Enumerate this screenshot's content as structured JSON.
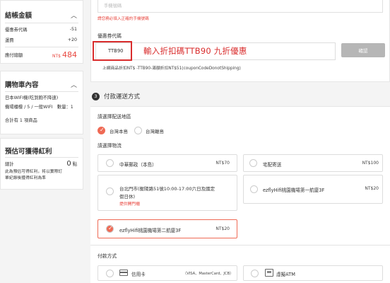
{
  "sidebar": {
    "checkout": {
      "title": "結帳金額",
      "rows": [
        {
          "label": "優惠券代碼",
          "value": "-51"
        },
        {
          "label": "運費",
          "value": "+20"
        }
      ],
      "total_label": "應付總額",
      "total_currency": "NT$",
      "total_value": "484"
    },
    "cart": {
      "title": "購物車內容",
      "items": [
        "日本WIFI機(吃到飽不降速)",
        "機場櫃檯 / 5 / 一般WIFI　數量：1"
      ],
      "count": "合計有 1 項商品"
    },
    "bonus": {
      "title": "預估可獲得紅利",
      "total_label": "總計",
      "points": "0",
      "points_unit": "點",
      "note_line1": "此為預估可得紅利，将以實際訂",
      "note_line2": "單紀錄後獲得紅利為準"
    }
  },
  "main": {
    "phone_placeholder": "手機號碼",
    "phone_error": "請您務必填入正確的手機號碼",
    "coupon": {
      "label": "優惠券代碼",
      "value": "TTB90",
      "annotation": "輸入折扣碼TTB90 九折優惠",
      "confirm": "確認",
      "note": "上網商品折扣NT$ -TTB90-滿額折扣NT$51(couponCodeDonotShipping)"
    },
    "section": {
      "number": "3",
      "title": "付款運送方式"
    },
    "region": {
      "label": "請選擇配送地區",
      "options": [
        "台灣本島",
        "台灣離島"
      ]
    },
    "logistics": {
      "label": "請選擇物流",
      "options": [
        {
          "name": "中華郵政（本島）",
          "price": "NT$70"
        },
        {
          "name": "宅配寄送",
          "price": "NT$100"
        },
        {
          "name_line1": "台北門市(衡陽路51號10:00-17:00六日及國定",
          "name_line2": "假日休)",
          "sub": "提供開門櫃"
        },
        {
          "name": "ezflyHifi桃園機場第一航廈3F",
          "price": "NT$20"
        },
        {
          "name": "ezflyHifi桃園機場第二航廈3F",
          "price": "NT$20"
        }
      ]
    },
    "payment": {
      "label": "付款方式",
      "options": [
        {
          "name": "信用卡",
          "cards": "（VISA、MasterCard、JCB）",
          "icon": "credit-card-icon"
        },
        {
          "name": "虛擬ATM",
          "icon": "atm-icon"
        }
      ]
    }
  },
  "colors": {
    "accent": "#ef6a55",
    "highlight": "#d92c2c",
    "total": "#e8473f"
  }
}
